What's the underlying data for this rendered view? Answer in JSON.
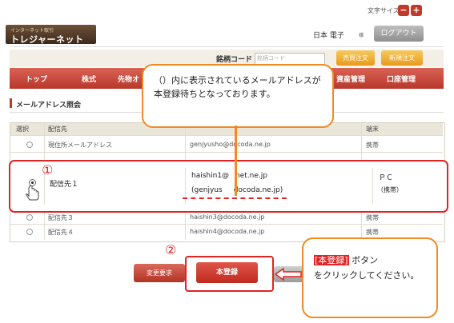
{
  "header": {
    "font_size_label": "文字サイズ",
    "font_minus": "−",
    "font_plus": "+",
    "logo_small": "インターネット取引",
    "logo_main": "トレジャーネット",
    "user_name": "日本 電子",
    "user_suffix": "様",
    "logout_label": "ログアウト"
  },
  "codebar": {
    "label": "銘柄コード",
    "placeholder": "銘柄コード",
    "buy_label": "売買注文",
    "new_order_label": "新規注文"
  },
  "nav": {
    "items": [
      "トップ",
      "株式",
      "先物オ",
      "資産管理",
      "口座管理"
    ]
  },
  "section": {
    "title": "メールアドレス照会"
  },
  "table": {
    "headers": [
      "選択",
      "配信先",
      "端末"
    ],
    "rows": [
      {
        "name": "現住所メールアドレス",
        "address": "genjyusho@docoda.ne.jp",
        "device": "携帯"
      },
      {
        "name": "配信先１",
        "address_line1": "haishin1@",
        "address_line1_tail": "net.ne.jp",
        "address_line2": "(genjyus",
        "address_line2_tail": "docoda.ne.jp)",
        "device_line1": "ＰＣ",
        "device_line2": "（携帯）"
      },
      {
        "name": "配信先３",
        "address": "haishin3@docoda.ne.jp",
        "device": "携帯"
      },
      {
        "name": "配信先４",
        "address": "haishin4@docoda.ne.jp",
        "device": "携帯"
      }
    ]
  },
  "buttons": {
    "change_request": "変更要求",
    "register": "本登録"
  },
  "callouts": {
    "top_text": "（）内に表示されているメールアドレスが本登録待ちとなっております。",
    "right_keyword": "[本登録]",
    "right_text_1": " ボタン",
    "right_text_2": "をクリックしてください。"
  },
  "markers": {
    "one": "①",
    "two": "②"
  },
  "colors": {
    "accent_red": "#e02424",
    "callout_orange": "#f08a24",
    "nav_red": "#c94538"
  }
}
